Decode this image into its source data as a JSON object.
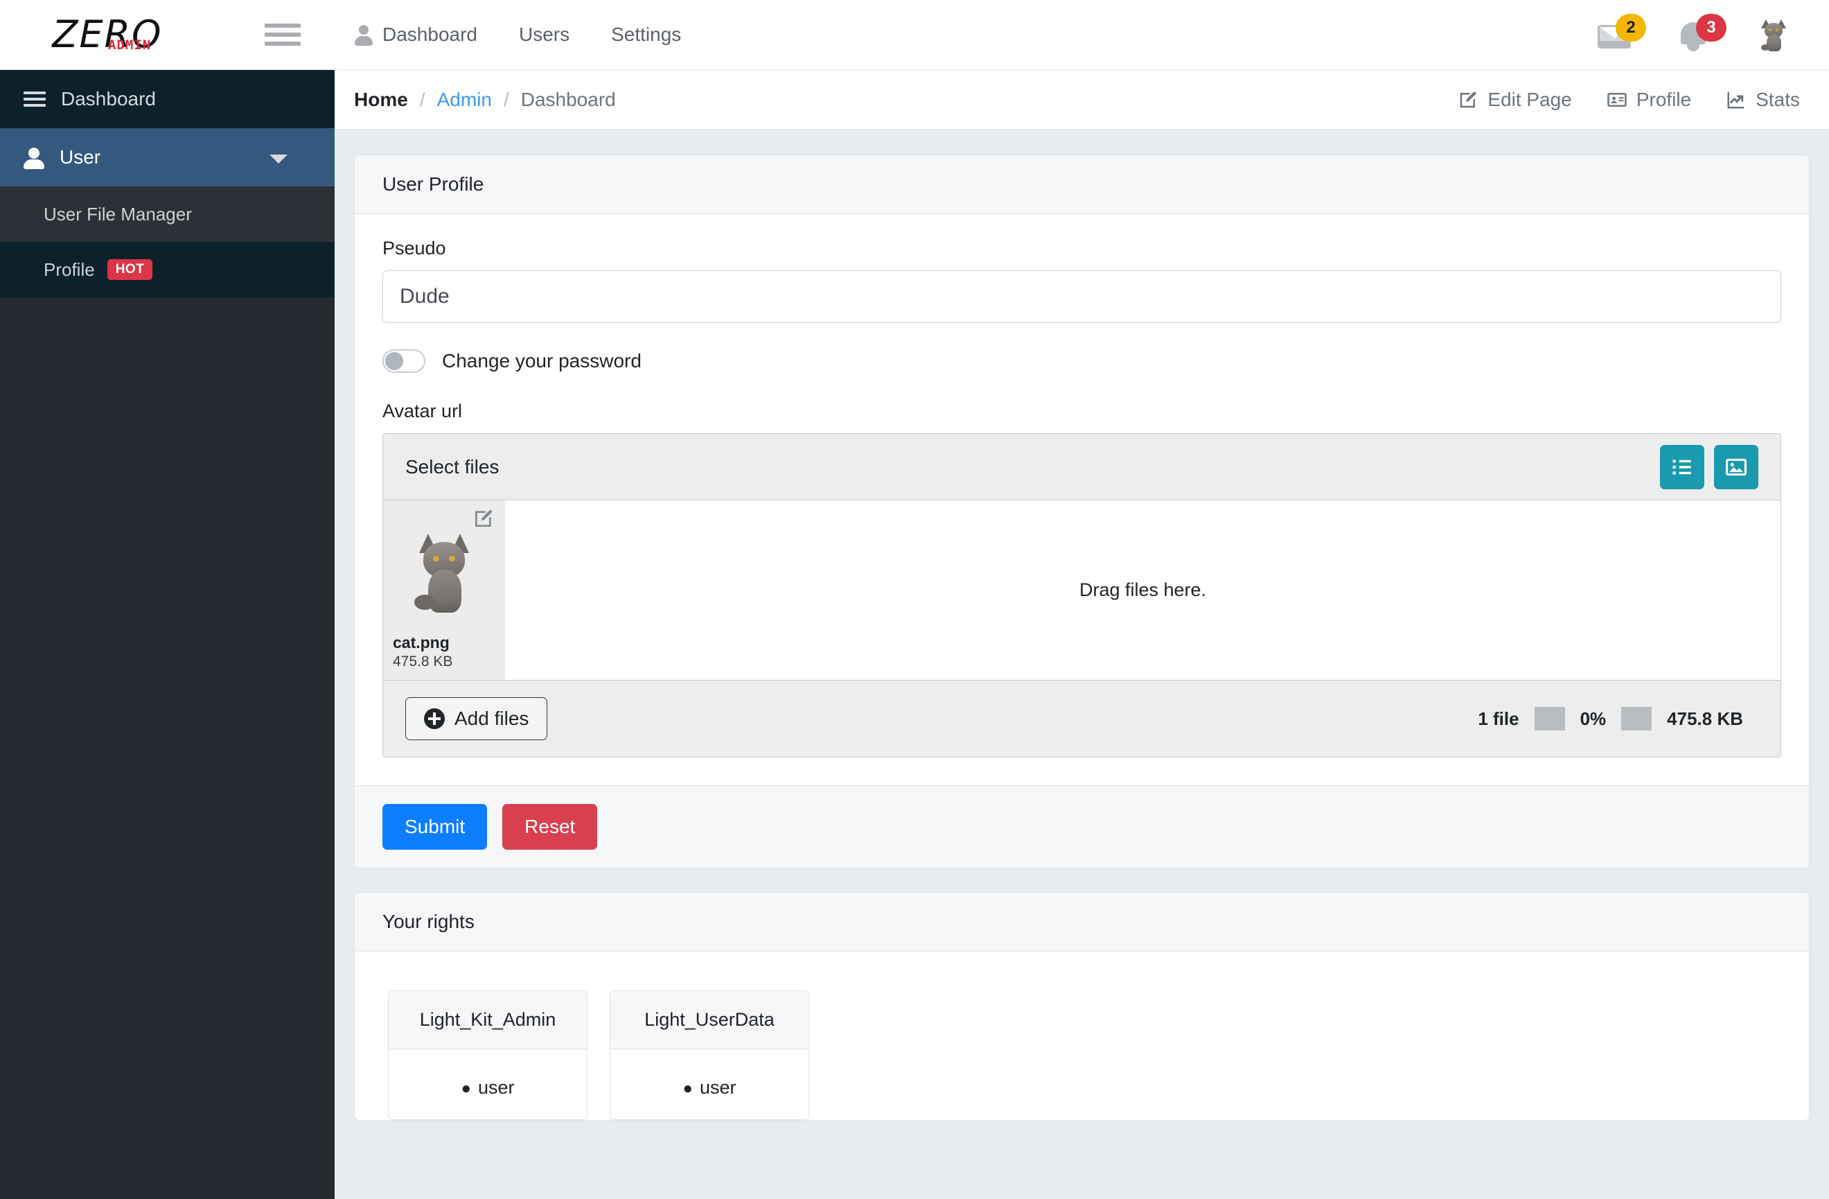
{
  "brand": {
    "zero": "ZERO",
    "admin": "ADMIN"
  },
  "topnav": {
    "items": [
      {
        "label": "Dashboard",
        "icon": "user-icon"
      },
      {
        "label": "Users",
        "icon": ""
      },
      {
        "label": "Settings",
        "icon": ""
      }
    ],
    "messages_badge": "2",
    "notifications_badge": "3"
  },
  "sidebar": {
    "dashboard_label": "Dashboard",
    "user_label": "User",
    "sub_items": [
      {
        "label": "User File Manager",
        "badge": ""
      },
      {
        "label": "Profile",
        "badge": "HOT"
      }
    ]
  },
  "breadcrumb": {
    "home": "Home",
    "sep": "/",
    "admin": "Admin",
    "current": "Dashboard"
  },
  "page_actions": [
    {
      "label": "Edit Page",
      "icon": "edit-square-icon"
    },
    {
      "label": "Profile",
      "icon": "id-card-icon"
    },
    {
      "label": "Stats",
      "icon": "chart-line-icon"
    }
  ],
  "profile_card": {
    "title": "User Profile",
    "pseudo_label": "Pseudo",
    "pseudo_value": "Dude",
    "pseudo_placeholder": "Pseudo",
    "password_toggle_label": "Change your password",
    "password_toggle_on": false,
    "avatar_label": "Avatar url",
    "uploader": {
      "select_files_label": "Select files",
      "drop_hint": "Drag files here.",
      "add_files_label": "Add files",
      "file": {
        "name": "cat.png",
        "size": "475.8 KB"
      },
      "stats": {
        "files": "1 file",
        "percent": "0%",
        "total": "475.8 KB"
      }
    },
    "submit_label": "Submit",
    "reset_label": "Reset"
  },
  "rights_card": {
    "title": "Your rights",
    "groups": [
      {
        "name": "Light_Kit_Admin",
        "items": [
          "user"
        ]
      },
      {
        "name": "Light_UserData",
        "items": [
          "user"
        ]
      }
    ]
  },
  "colors": {
    "accent_blue": "#0d7efd",
    "danger_red": "#d8404f",
    "teal": "#1a9aae",
    "sidebar_dark": "#242a30",
    "sidebar_active": "#35597e",
    "link_blue": "#3d9ae8",
    "badge_warn": "#f3b700",
    "badge_danger": "#dc3545",
    "brand_red": "#d6283b"
  }
}
